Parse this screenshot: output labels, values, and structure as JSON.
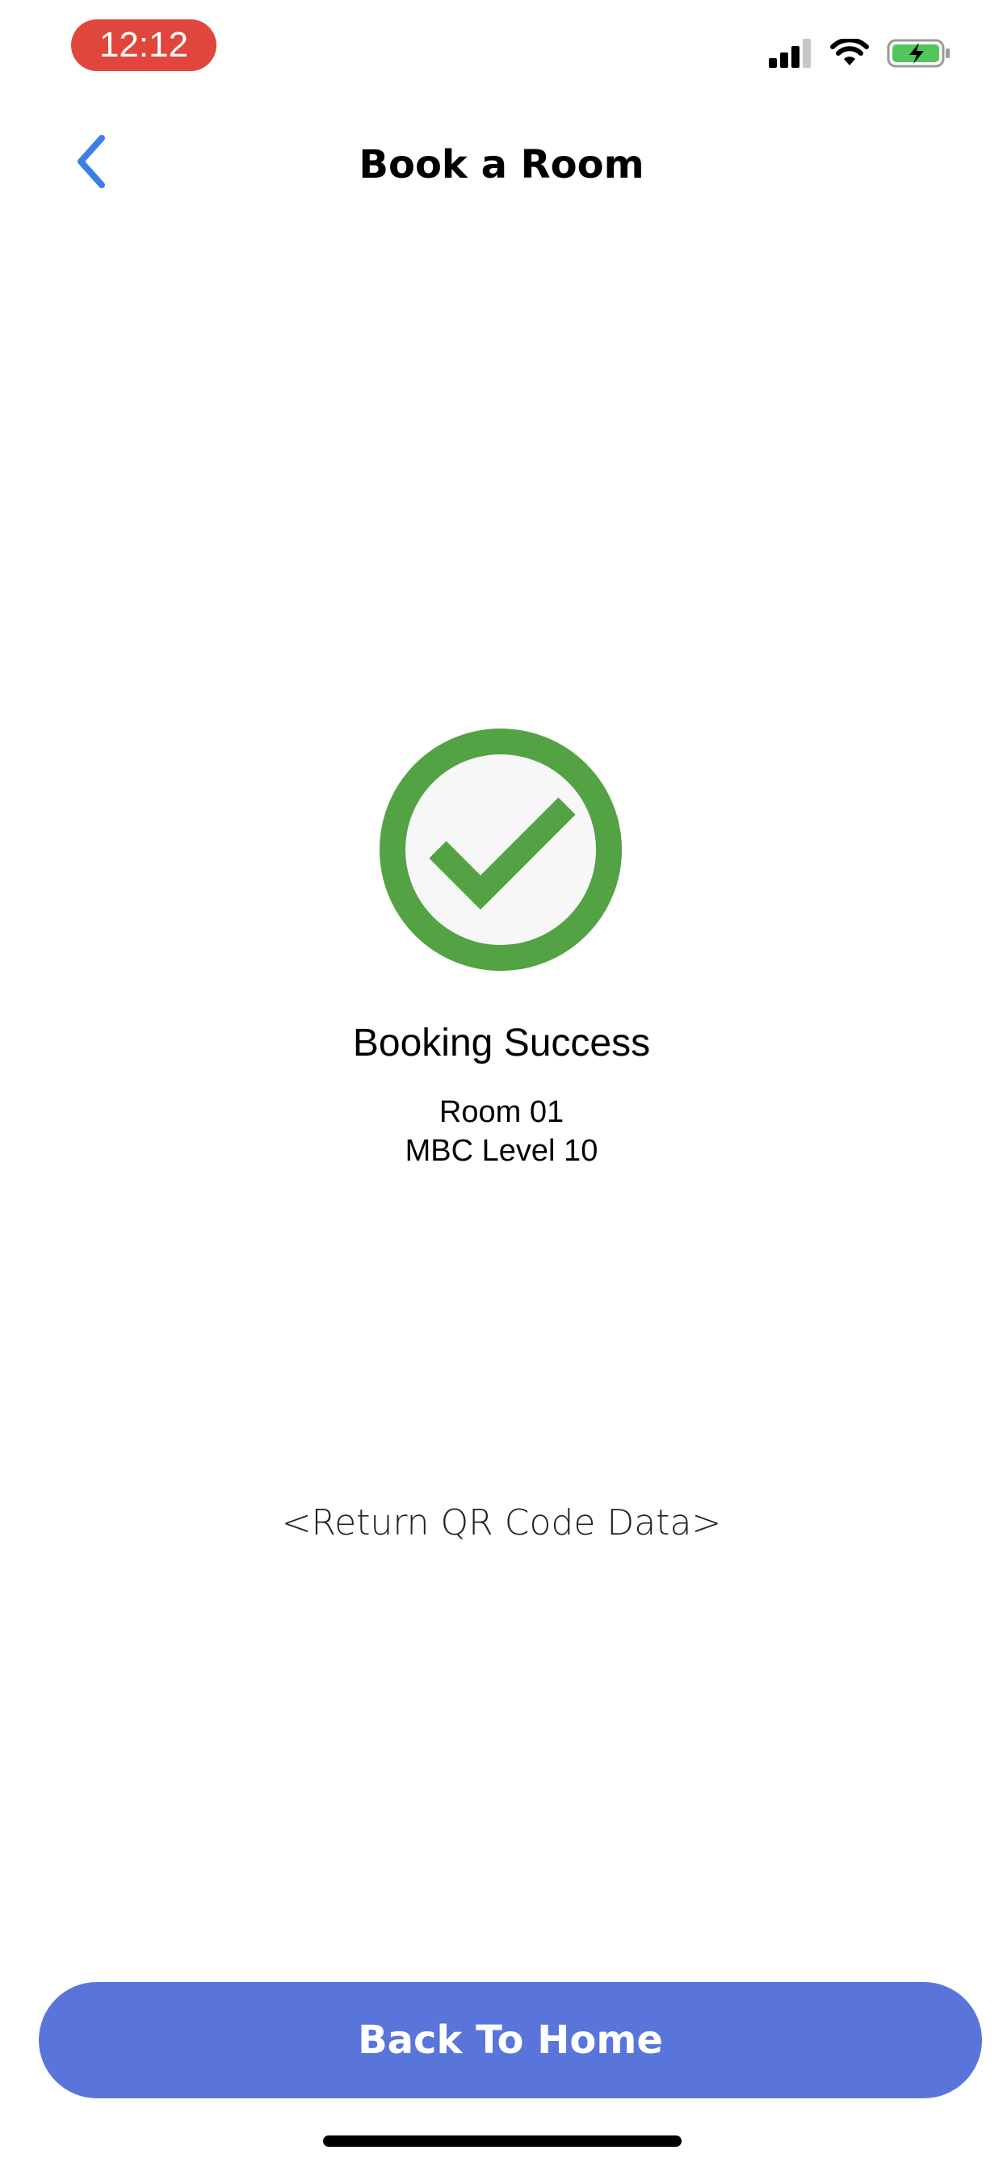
{
  "status_bar": {
    "time": "12:12",
    "icons": [
      "cellular-signal-icon",
      "wifi-icon",
      "battery-charging-icon"
    ]
  },
  "nav": {
    "back_icon": "chevron-left-icon",
    "title": "Book a Room"
  },
  "result": {
    "icon": "check-circle-icon",
    "title": "Booking Success",
    "room": "Room 01",
    "location": "MBC Level 10"
  },
  "qr": {
    "data": "<Return QR Code Data>"
  },
  "actions": {
    "home_label": "Back To Home"
  },
  "colors": {
    "accent": "#5a75d9",
    "back_chevron": "#3b7de9",
    "success": "#53a244",
    "time_pill": "#e0463b",
    "battery": "#52c65a"
  }
}
